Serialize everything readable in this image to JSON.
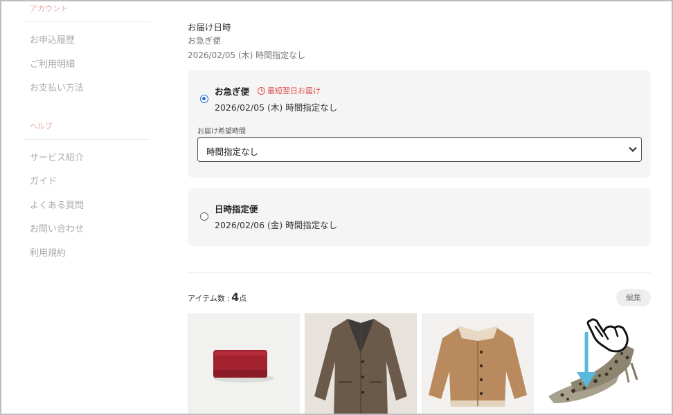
{
  "sidebar": {
    "account_heading": "アカウント",
    "account_items": [
      {
        "label": "お申込履歴"
      },
      {
        "label": "ご利用明細"
      },
      {
        "label": "お支払い方法"
      }
    ],
    "help_heading": "ヘルプ",
    "help_items": [
      {
        "label": "サービス紹介"
      },
      {
        "label": "ガイド"
      },
      {
        "label": "よくある質問"
      },
      {
        "label": "お問い合わせ"
      },
      {
        "label": "利用規約"
      }
    ]
  },
  "delivery": {
    "title": "お届け日時",
    "method": "お急ぎ便",
    "date": "2026/02/05 (木) 時間指定なし"
  },
  "options": [
    {
      "name": "お急ぎ便",
      "badge": "最短翌日お届け",
      "sub": "2026/02/05 (木) 時間指定なし",
      "selected": true,
      "time_label": "お届け希望時間",
      "time_value": "時間指定なし"
    },
    {
      "name": "日時指定便",
      "sub": "2026/02/06 (金) 時間指定なし",
      "selected": false
    }
  ],
  "items": {
    "count_label": "アイテム数 : ",
    "count": "4",
    "unit": "点",
    "edit_label": "編集",
    "thumbnails": [
      {
        "name": "red-wallet"
      },
      {
        "name": "brown-tweed-coat"
      },
      {
        "name": "camel-boa-jacket"
      },
      {
        "name": "python-pumps"
      }
    ]
  },
  "colors": {
    "accent_radio": "#2b6de0",
    "badge_red": "#e04b4b",
    "sidebar_heading": "#e8a7a7",
    "scroll_arrow": "#5bb8dd"
  }
}
